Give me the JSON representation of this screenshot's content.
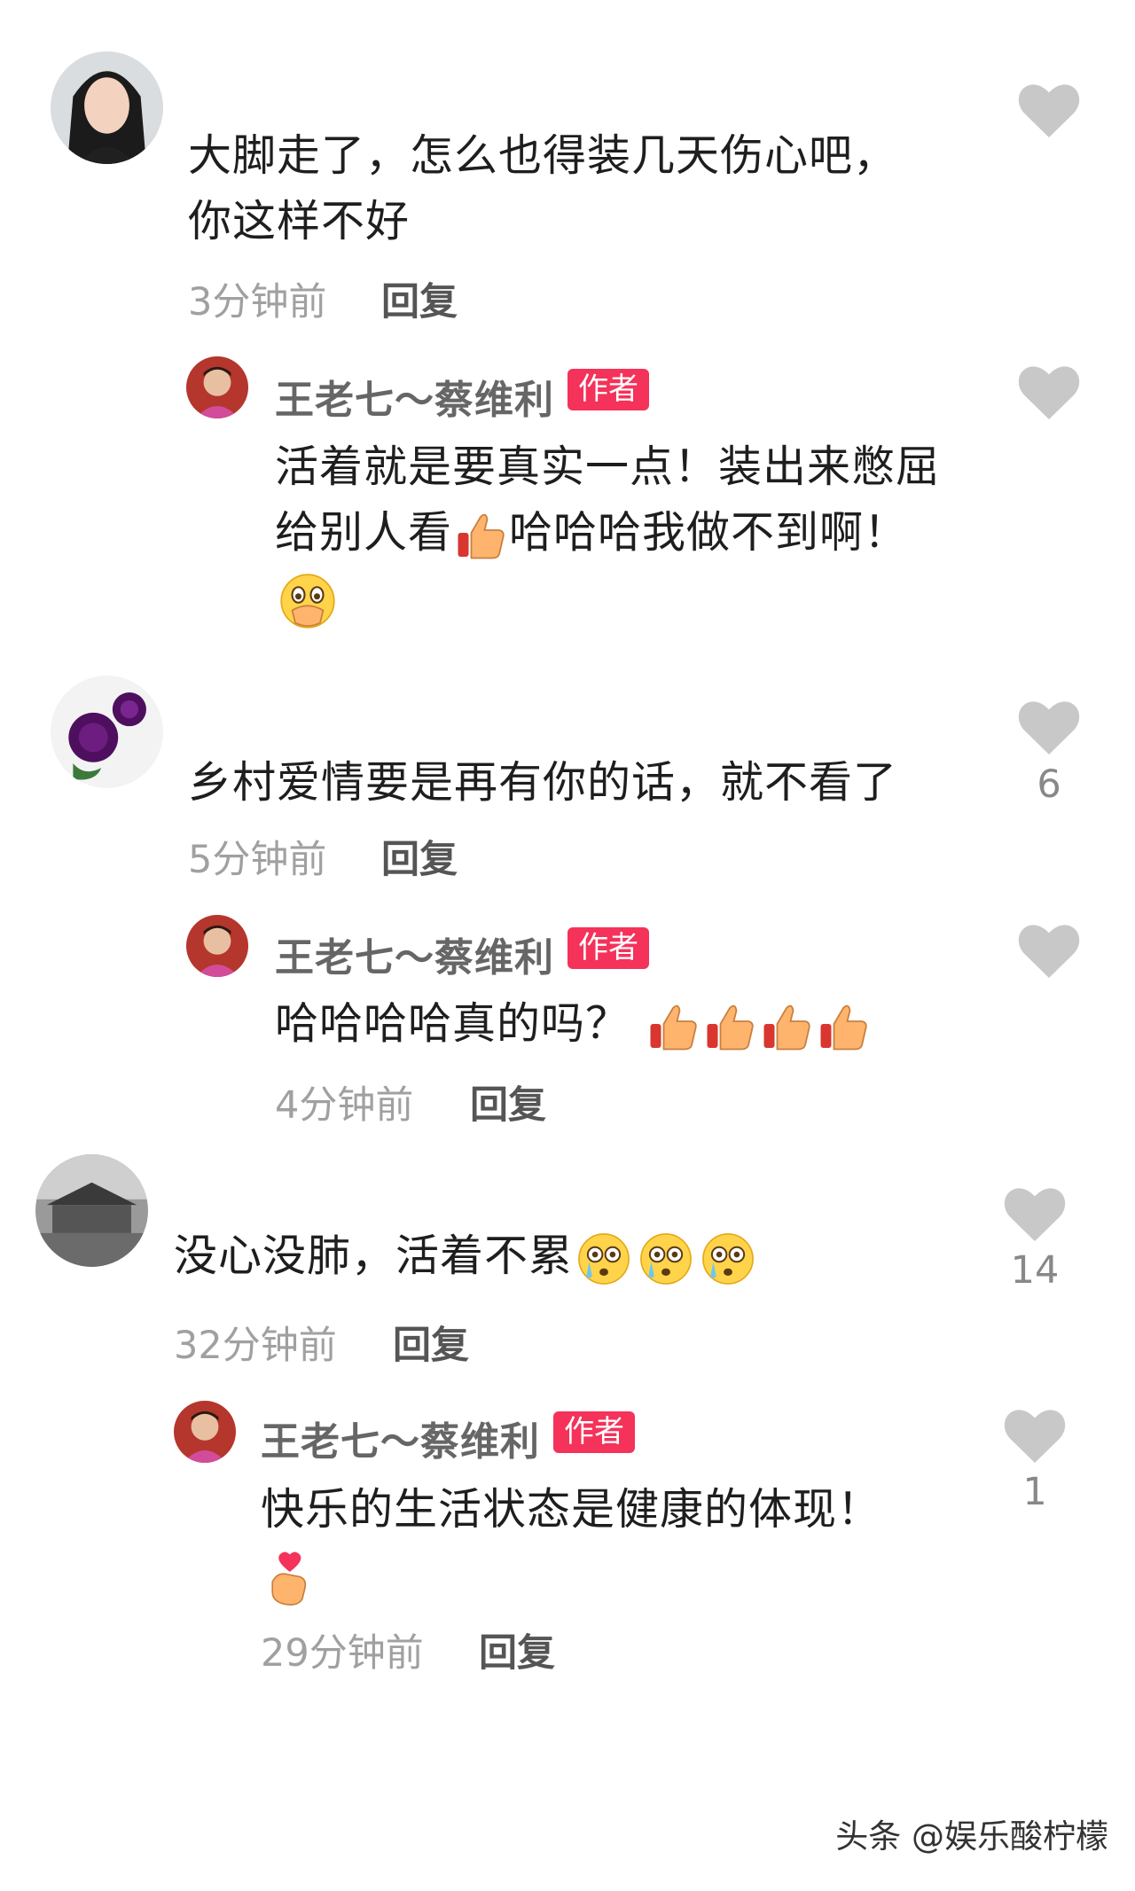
{
  "comments": [
    {
      "text_line1": "大脚走了，怎么也得装几天伤心吧，",
      "text_line2": "你这样不好",
      "time": "3分钟前",
      "reply_label": "回复",
      "like_count": "",
      "reply": {
        "author": "王老七～蔡维利",
        "badge": "作者",
        "text_line1": "活着就是要真实一点！装出来憋屈",
        "text_line2a": "给别人看",
        "text_line2b": "哈哈哈我做不到啊！",
        "emojis": [
          "thumbs-up",
          "hand-over-mouth"
        ]
      }
    },
    {
      "text_line1": "乡村爱情要是再有你的话，就不看了",
      "time": "5分钟前",
      "reply_label": "回复",
      "like_count": "6",
      "reply": {
        "author": "王老七～蔡维利",
        "badge": "作者",
        "text_line1": "哈哈哈哈真的吗？",
        "time": "4分钟前",
        "reply_label": "回复",
        "emojis": [
          "thumbs-up",
          "thumbs-up",
          "thumbs-up",
          "thumbs-up"
        ]
      }
    },
    {
      "text_line1": "没心没肺，活着不累",
      "time": "32分钟前",
      "reply_label": "回复",
      "like_count": "14",
      "reply": {
        "author": "王老七～蔡维利",
        "badge": "作者",
        "text_line1": "快乐的生活状态是健康的体现！",
        "time": "29分钟前",
        "reply_label": "回复",
        "like_count": "1",
        "emojis": [
          "finger-heart"
        ]
      }
    }
  ],
  "watermark": "头条 @娱乐酸柠檬",
  "colors": {
    "badge": "#f4325a",
    "heart": "#c8c8c8"
  }
}
